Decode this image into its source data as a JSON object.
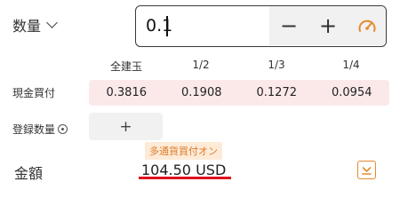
{
  "quantity": {
    "label": "数量",
    "value": "0.1",
    "minus": "−",
    "plus": "+"
  },
  "columns": [
    "全建玉",
    "1/2",
    "1/3",
    "1/4"
  ],
  "buy_row": {
    "label": "現金買付",
    "values": [
      "0.3816",
      "0.1908",
      "0.1272",
      "0.0954"
    ]
  },
  "registered": {
    "label": "登録数量",
    "add": "+"
  },
  "badge": "多通貨買付オン",
  "amount": {
    "label": "金額",
    "value": "104.50 USD"
  },
  "colors": {
    "accent_orange": "#e58a2e",
    "underline_red": "#e0111d",
    "buy_row_bg": "#fbe9ea",
    "badge_bg": "#fdebd8"
  },
  "icons": {
    "quantity_dropdown": "chevron-down-icon",
    "speed": "gauge-icon",
    "registered_info": "target-icon",
    "expand": "expand-down-icon"
  }
}
